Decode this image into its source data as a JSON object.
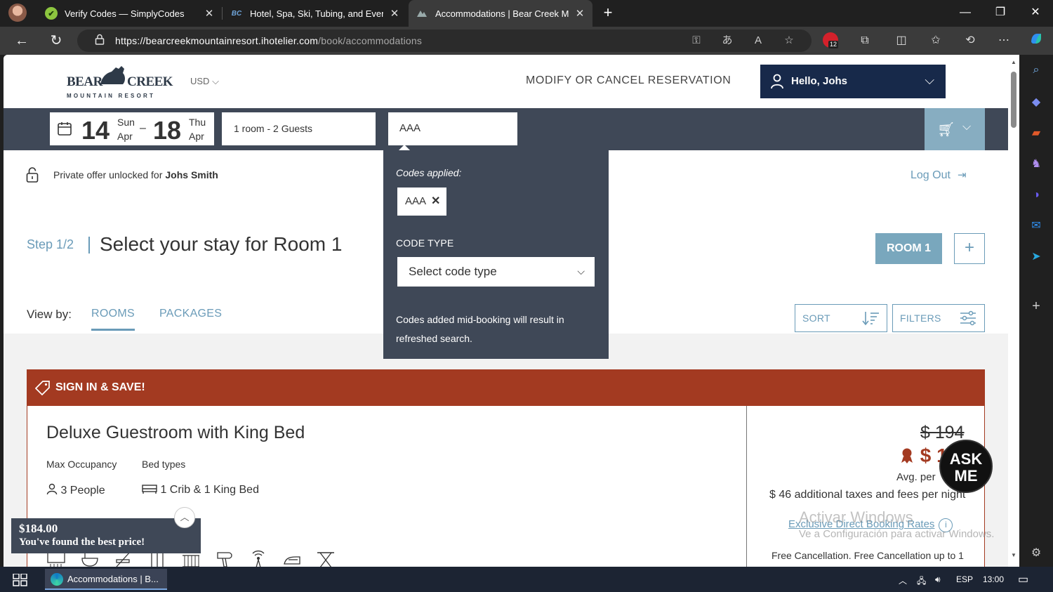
{
  "browser": {
    "tabs": [
      {
        "title": "Verify Codes — SimplyCodes",
        "favicon": "simplycodes-icon",
        "fav_glyph": "✔",
        "fav_color": "#8dc63f"
      },
      {
        "title": "Hotel, Spa, Ski, Tubing, and Even",
        "favicon": "bearcreek-icon",
        "fav_glyph": "BC",
        "fav_color": "#202020"
      },
      {
        "title": "Accommodations | Bear Creek M",
        "favicon": "bearcreek-icon",
        "fav_glyph": "",
        "fav_color": "#3b3b3b"
      }
    ],
    "url_host": "https://bearcreekmountainresort.ihotelier.com",
    "url_path": "/book/accommodations"
  },
  "header": {
    "logo_word1": "BEAR",
    "logo_word2": "CREEK",
    "logo_sub": "MOUNTAIN RESORT",
    "currency": "USD",
    "modify": "MODIFY OR CANCEL RESERVATION",
    "hello": "Hello, Johs"
  },
  "search": {
    "checkin_day": "14",
    "checkin_dow": "Sun",
    "checkin_mon": "Apr",
    "checkout_day": "18",
    "checkout_dow": "Thu",
    "checkout_mon": "Apr",
    "guests": "1 room - 2 Guests",
    "code": "AAA"
  },
  "offer": {
    "text": "Private offer unlocked for",
    "name": "Johs Smith",
    "logout": "Log Out"
  },
  "step": {
    "label": "Step 1/2",
    "title": "Select your stay for Room 1",
    "room_button": "ROOM 1",
    "add_room": "+"
  },
  "view": {
    "label": "View by:",
    "rooms": "ROOMS",
    "packages": "PACKAGES",
    "sort": "SORT",
    "filters": "FILTERS"
  },
  "promo": {
    "codes_applied": "Codes applied:",
    "applied_code": "AAA",
    "code_type_label": "CODE TYPE",
    "select_placeholder": "Select code type",
    "note": "Codes added mid-booking will result in refreshed search."
  },
  "banner": {
    "sign_in": "SIGN IN & SAVE!"
  },
  "room": {
    "name": "Deluxe Guestroom with King Bed",
    "max_occ_label": "Max Occupancy",
    "bed_types_label": "Bed types",
    "occupancy": "3 People",
    "beds": "1 Crib & 1 King Bed",
    "old_price": "$ 194",
    "new_price": "$ 1",
    "avg": "Avg. per",
    "taxes": "$ 46 additional taxes and fees per night",
    "exclusive": "Exclusive Direct Booking Rates",
    "free_cancel": "Free Cancellation. Free Cancellation up to 1"
  },
  "ask": {
    "line1": "ASK",
    "line2": "ME"
  },
  "toast": {
    "price": "$184.00",
    "message": "You've found the best price!"
  },
  "watermark": {
    "line1": "Activar Windows",
    "line2": "Ve a Configuración para activar Windows."
  },
  "taskbar": {
    "app": "Accommodations | B...",
    "lang": "ESP",
    "time": "13:00"
  },
  "colors": {
    "navy": "#17294a",
    "band": "#3f4857",
    "accent": "#6a9bb8",
    "sign_in_red": "#a33a21"
  }
}
